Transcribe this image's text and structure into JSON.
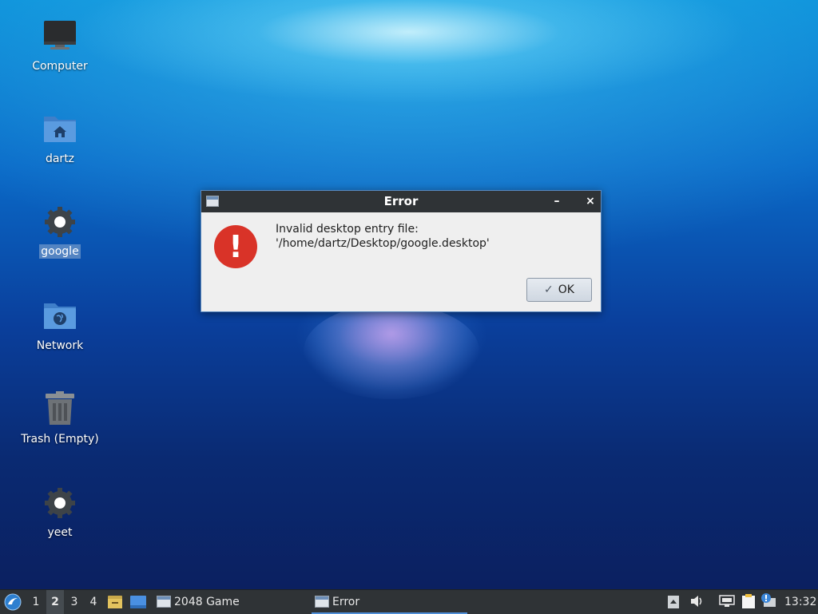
{
  "desktop": {
    "icons": [
      {
        "label": "Computer",
        "icon": "computer-icon"
      },
      {
        "label": "dartz",
        "icon": "home-folder-icon"
      },
      {
        "label": "google",
        "icon": "gear-icon",
        "selected": true
      },
      {
        "label": "Network",
        "icon": "network-folder-icon"
      },
      {
        "label": "Trash (Empty)",
        "icon": "trash-icon"
      },
      {
        "label": "yeet",
        "icon": "gear-icon"
      }
    ]
  },
  "dialog": {
    "title": "Error",
    "minimize_label": "–",
    "close_label": "×",
    "message": "Invalid desktop entry file: '/home/dartz/Desktop/google.desktop'",
    "icon": "error-icon",
    "ok_label": "OK"
  },
  "taskbar": {
    "workspaces": [
      "1",
      "2",
      "3",
      "4"
    ],
    "active_workspace": "2",
    "tasks": [
      {
        "label": "2048 Game",
        "active": false
      },
      {
        "label": "Error",
        "active": true
      }
    ],
    "clock": "13:32"
  },
  "colors": {
    "titlebar": "#2f3336",
    "error_red": "#d93328",
    "taskbar": "#2f3336",
    "accent": "#4f8fd8"
  }
}
